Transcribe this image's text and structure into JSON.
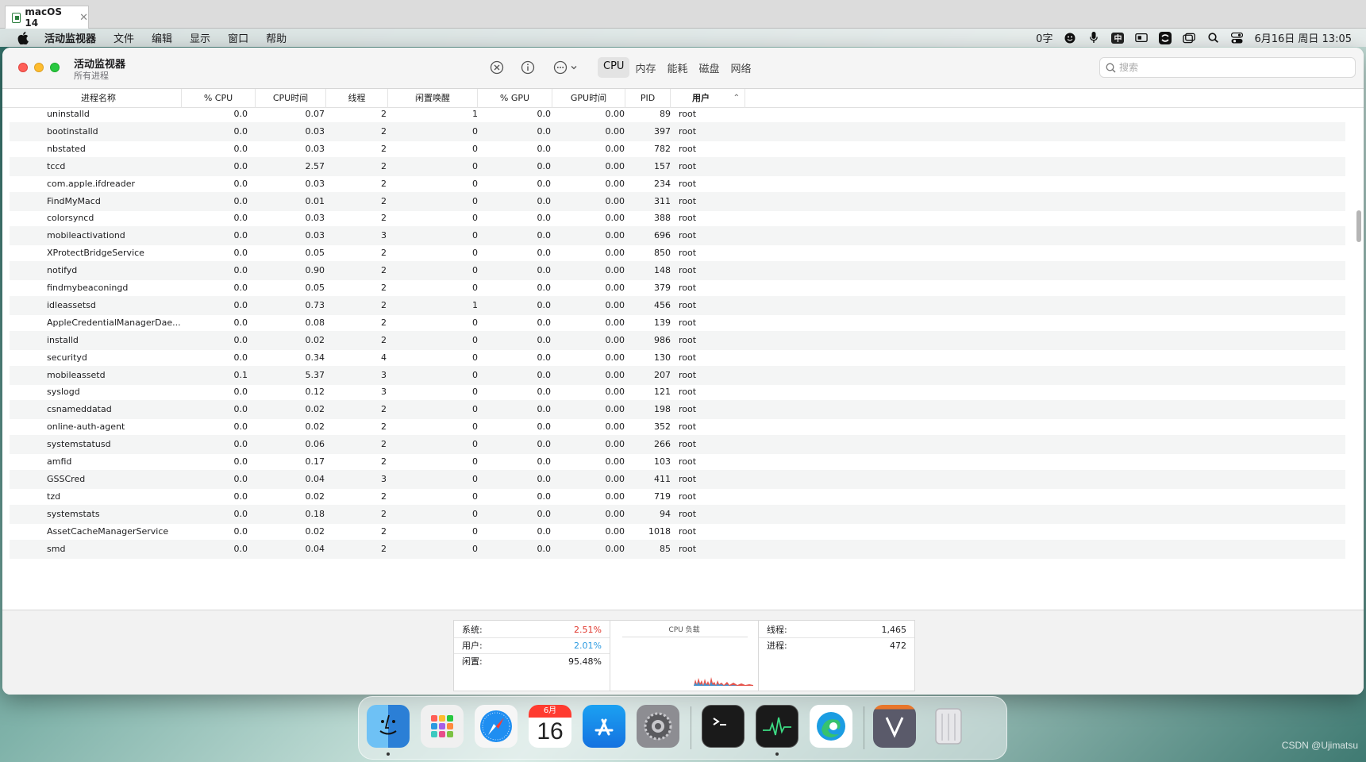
{
  "vm_tab": {
    "title": "macOS 14",
    "close": "✕"
  },
  "menubar": {
    "app_name": "活动监视器",
    "items": [
      "文件",
      "编辑",
      "显示",
      "窗口",
      "帮助"
    ],
    "input_status": "0字",
    "ime": "中",
    "datetime": "6月16日 周日 13:05"
  },
  "window": {
    "title": "活动监视器",
    "subtitle": "所有进程",
    "tabs": [
      "CPU",
      "内存",
      "能耗",
      "磁盘",
      "网络"
    ],
    "active_tab": "CPU",
    "search_placeholder": "搜索"
  },
  "table": {
    "columns": [
      "进程名称",
      "% CPU",
      "CPU时间",
      "线程",
      "闲置唤醒",
      "% GPU",
      "GPU时间",
      "PID",
      "用户"
    ],
    "sort_column": "用户",
    "sort_arrow": "⌃",
    "rows": [
      [
        "uninstalld",
        "0.0",
        "0.07",
        "2",
        "1",
        "0.0",
        "0.00",
        "89",
        "root"
      ],
      [
        "bootinstalld",
        "0.0",
        "0.03",
        "2",
        "0",
        "0.0",
        "0.00",
        "397",
        "root"
      ],
      [
        "nbstated",
        "0.0",
        "0.03",
        "2",
        "0",
        "0.0",
        "0.00",
        "782",
        "root"
      ],
      [
        "tccd",
        "0.0",
        "2.57",
        "2",
        "0",
        "0.0",
        "0.00",
        "157",
        "root"
      ],
      [
        "com.apple.ifdreader",
        "0.0",
        "0.03",
        "2",
        "0",
        "0.0",
        "0.00",
        "234",
        "root"
      ],
      [
        "FindMyMacd",
        "0.0",
        "0.01",
        "2",
        "0",
        "0.0",
        "0.00",
        "311",
        "root"
      ],
      [
        "colorsyncd",
        "0.0",
        "0.03",
        "2",
        "0",
        "0.0",
        "0.00",
        "388",
        "root"
      ],
      [
        "mobileactivationd",
        "0.0",
        "0.03",
        "3",
        "0",
        "0.0",
        "0.00",
        "696",
        "root"
      ],
      [
        "XProtectBridgeService",
        "0.0",
        "0.05",
        "2",
        "0",
        "0.0",
        "0.00",
        "850",
        "root"
      ],
      [
        "notifyd",
        "0.0",
        "0.90",
        "2",
        "0",
        "0.0",
        "0.00",
        "148",
        "root"
      ],
      [
        "findmybeaconingd",
        "0.0",
        "0.05",
        "2",
        "0",
        "0.0",
        "0.00",
        "379",
        "root"
      ],
      [
        "idleassetsd",
        "0.0",
        "0.73",
        "2",
        "1",
        "0.0",
        "0.00",
        "456",
        "root"
      ],
      [
        "AppleCredentialManagerDae...",
        "0.0",
        "0.08",
        "2",
        "0",
        "0.0",
        "0.00",
        "139",
        "root"
      ],
      [
        "installd",
        "0.0",
        "0.02",
        "2",
        "0",
        "0.0",
        "0.00",
        "986",
        "root"
      ],
      [
        "securityd",
        "0.0",
        "0.34",
        "4",
        "0",
        "0.0",
        "0.00",
        "130",
        "root"
      ],
      [
        "mobileassetd",
        "0.1",
        "5.37",
        "3",
        "0",
        "0.0",
        "0.00",
        "207",
        "root"
      ],
      [
        "syslogd",
        "0.0",
        "0.12",
        "3",
        "0",
        "0.0",
        "0.00",
        "121",
        "root"
      ],
      [
        "csnameddatad",
        "0.0",
        "0.02",
        "2",
        "0",
        "0.0",
        "0.00",
        "198",
        "root"
      ],
      [
        "online-auth-agent",
        "0.0",
        "0.02",
        "2",
        "0",
        "0.0",
        "0.00",
        "352",
        "root"
      ],
      [
        "systemstatusd",
        "0.0",
        "0.06",
        "2",
        "0",
        "0.0",
        "0.00",
        "266",
        "root"
      ],
      [
        "amfid",
        "0.0",
        "0.17",
        "2",
        "0",
        "0.0",
        "0.00",
        "103",
        "root"
      ],
      [
        "GSSCred",
        "0.0",
        "0.04",
        "3",
        "0",
        "0.0",
        "0.00",
        "411",
        "root"
      ],
      [
        "tzd",
        "0.0",
        "0.02",
        "2",
        "0",
        "0.0",
        "0.00",
        "719",
        "root"
      ],
      [
        "systemstats",
        "0.0",
        "0.18",
        "2",
        "0",
        "0.0",
        "0.00",
        "94",
        "root"
      ],
      [
        "AssetCacheManagerService",
        "0.0",
        "0.02",
        "2",
        "0",
        "0.0",
        "0.00",
        "1018",
        "root"
      ],
      [
        "smd",
        "0.0",
        "0.04",
        "2",
        "0",
        "0.0",
        "0.00",
        "85",
        "root"
      ]
    ]
  },
  "stats": {
    "system_label": "系统:",
    "system_value": "2.51%",
    "user_label": "用户:",
    "user_value": "2.01%",
    "idle_label": "闲置:",
    "idle_value": "95.48%",
    "cpu_load_title": "CPU 负载",
    "threads_label": "线程:",
    "threads_value": "1,465",
    "processes_label": "进程:",
    "processes_value": "472"
  },
  "dock": {
    "calendar_month": "6月",
    "calendar_day": "16",
    "apps": [
      "finder-icon",
      "launchpad-icon",
      "safari-icon",
      "calendar-icon",
      "app-store-icon",
      "system-settings-icon",
      "terminal-icon",
      "activity-monitor-icon",
      "edge-icon",
      "vim-icon",
      "trash-icon"
    ]
  },
  "watermark": "CSDN @Ujimatsu",
  "colors": {
    "system_red": "#e0352b",
    "user_blue": "#2b9ae0"
  }
}
